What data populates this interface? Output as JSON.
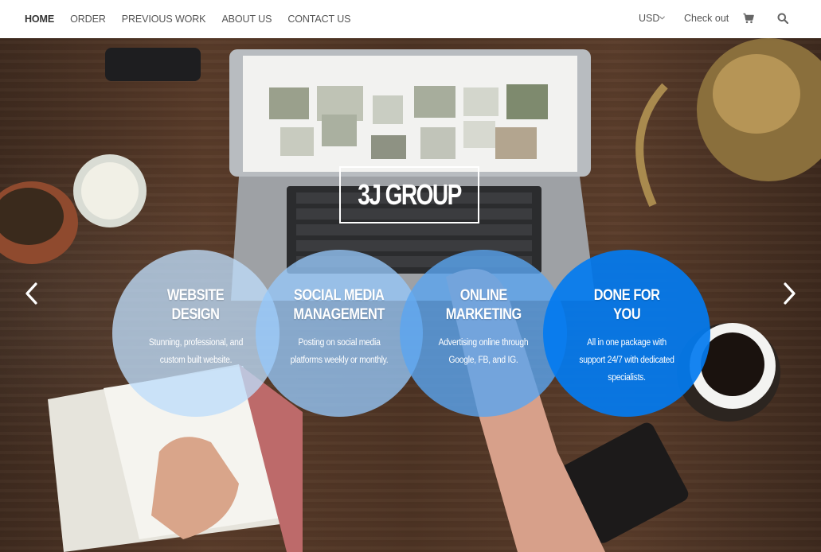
{
  "nav": {
    "items": [
      {
        "label": "HOME",
        "active": true
      },
      {
        "label": "ORDER"
      },
      {
        "label": "PREVIOUS WORK"
      },
      {
        "label": "ABOUT US"
      },
      {
        "label": "CONTACT US"
      }
    ],
    "currency": "USD",
    "checkout": "Check out",
    "icons": [
      "chevron-down-icon",
      "cart-icon",
      "search-icon"
    ]
  },
  "hero": {
    "title": "3J GROUP",
    "services": [
      {
        "title_line1": "WEBSITE",
        "title_line2": "DESIGN",
        "desc": "Stunning, professional, and custom built website."
      },
      {
        "title_line1": "SOCIAL MEDIA",
        "title_line2": "MANAGEMENT",
        "desc": "Posting on social media platforms weekly or monthly."
      },
      {
        "title_line1": "ONLINE",
        "title_line2": "MARKETING",
        "desc": "Advertising online through Google, FB, and IG."
      },
      {
        "title_line1": "DONE FOR",
        "title_line2": "YOU",
        "desc": "All in one package with support 24/7 with dedicated specialists."
      }
    ],
    "arrows": [
      "chevron-left-icon",
      "chevron-right-icon"
    ]
  },
  "colors": {
    "nav_bg": "#ffffff",
    "nav_text": "#555555",
    "circle_1": "#bedcfa",
    "circle_2": "#96c8fa",
    "circle_3": "#5aa5f0",
    "circle_4": "#037bf0"
  }
}
